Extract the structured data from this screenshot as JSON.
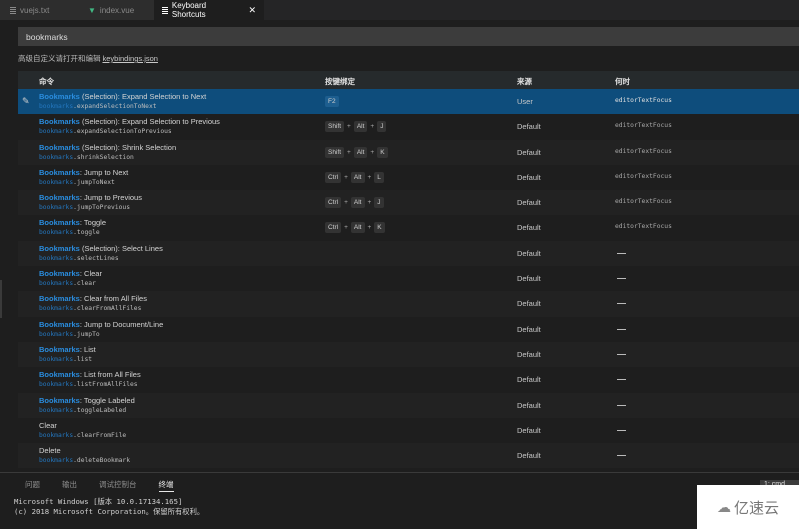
{
  "tabs": [
    {
      "label": "vuejs.txt",
      "icon": "file-lines-icon",
      "active": false
    },
    {
      "label": "index.vue",
      "icon": "vue-icon",
      "active": false
    },
    {
      "label": "Keyboard Shortcuts",
      "icon": "file-lines-icon",
      "active": true
    }
  ],
  "search": {
    "value": "bookmarks"
  },
  "hint": {
    "text": "高级自定义请打开和编辑",
    "link": "keybindings.json"
  },
  "table": {
    "headers": {
      "command": "命令",
      "keybinding": "按键绑定",
      "source": "来源",
      "when": "何时"
    },
    "rows": [
      {
        "prefix": "Bookmarks",
        "title": " (Selection): Expand Selection to Next",
        "ns": "bookmarks",
        "id": ".expandSelectionToNext",
        "keys": [
          "F2"
        ],
        "source": "User",
        "when": "editorTextFocus",
        "selected": true
      },
      {
        "prefix": "Bookmarks",
        "title": " (Selection): Expand Selection to Previous",
        "ns": "bookmarks",
        "id": ".expandSelectionToPrevious",
        "keys": [
          "Shift",
          "Alt",
          "J"
        ],
        "source": "Default",
        "when": "editorTextFocus"
      },
      {
        "prefix": "Bookmarks",
        "title": " (Selection): Shrink Selection",
        "ns": "bookmarks",
        "id": ".shrinkSelection",
        "keys": [
          "Shift",
          "Alt",
          "K"
        ],
        "source": "Default",
        "when": "editorTextFocus"
      },
      {
        "prefix": "Bookmarks",
        "title": ": Jump to Next",
        "ns": "bookmarks",
        "id": ".jumpToNext",
        "keys": [
          "Ctrl",
          "Alt",
          "L"
        ],
        "source": "Default",
        "when": "editorTextFocus"
      },
      {
        "prefix": "Bookmarks",
        "title": ": Jump to Previous",
        "ns": "bookmarks",
        "id": ".jumpToPrevious",
        "keys": [
          "Ctrl",
          "Alt",
          "J"
        ],
        "source": "Default",
        "when": "editorTextFocus"
      },
      {
        "prefix": "Bookmarks",
        "title": ": Toggle",
        "ns": "bookmarks",
        "id": ".toggle",
        "keys": [
          "Ctrl",
          "Alt",
          "K"
        ],
        "source": "Default",
        "when": "editorTextFocus"
      },
      {
        "prefix": "Bookmarks",
        "title": " (Selection): Select Lines",
        "ns": "bookmarks",
        "id": ".selectLines",
        "keys": [],
        "source": "Default",
        "when": "—"
      },
      {
        "prefix": "Bookmarks",
        "title": ": Clear",
        "ns": "bookmarks",
        "id": ".clear",
        "keys": [],
        "source": "Default",
        "when": "—"
      },
      {
        "prefix": "Bookmarks",
        "title": ": Clear from All Files",
        "ns": "bookmarks",
        "id": ".clearFromAllFiles",
        "keys": [],
        "source": "Default",
        "when": "—"
      },
      {
        "prefix": "Bookmarks",
        "title": ": Jump to Document/Line",
        "ns": "bookmarks",
        "id": ".jumpTo",
        "keys": [],
        "source": "Default",
        "when": "—"
      },
      {
        "prefix": "Bookmarks",
        "title": ": List",
        "ns": "bookmarks",
        "id": ".list",
        "keys": [],
        "source": "Default",
        "when": "—"
      },
      {
        "prefix": "Bookmarks",
        "title": ": List from All Files",
        "ns": "bookmarks",
        "id": ".listFromAllFiles",
        "keys": [],
        "source": "Default",
        "when": "—"
      },
      {
        "prefix": "Bookmarks",
        "title": ": Toggle Labeled",
        "ns": "bookmarks",
        "id": ".toggleLabeled",
        "keys": [],
        "source": "Default",
        "when": "—"
      },
      {
        "prefix": "",
        "title": "Clear",
        "ns": "bookmarks",
        "id": ".clearFromFile",
        "keys": [],
        "source": "Default",
        "when": "—"
      },
      {
        "prefix": "",
        "title": "Delete",
        "ns": "bookmarks",
        "id": ".deleteBookmark",
        "keys": [],
        "source": "Default",
        "when": "—"
      }
    ]
  },
  "panel": {
    "tabs": [
      "问题",
      "输出",
      "调试控制台",
      "终端"
    ],
    "active_tab": 3,
    "terminal_lines": [
      "Microsoft Windows [版本 10.0.17134.165]",
      "(c) 2018 Microsoft Corporation。保留所有权利。"
    ],
    "terminal_select": "1: cmd"
  },
  "watermark": {
    "text": "亿速云"
  }
}
